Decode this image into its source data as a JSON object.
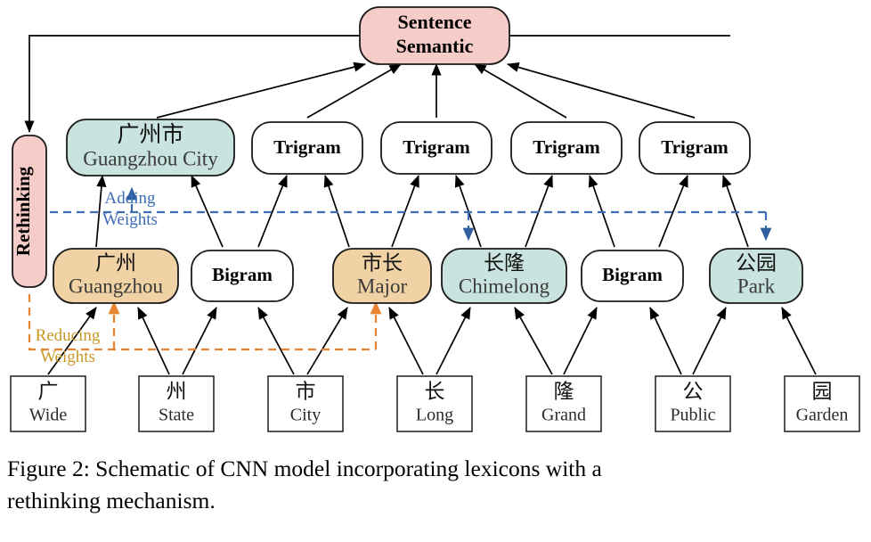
{
  "figure": {
    "caption_line1": "Figure 2:  Schematic of CNN model incorporating lexicons with a",
    "caption_line2": "rethinking mechanism."
  },
  "colors": {
    "pink": "#F5CCC8",
    "teal": "#C9E3DF",
    "orange": "#F0D2A4",
    "white": "#FFFFFF",
    "blue_annotation": "#3C6CB4",
    "orange_annotation": "#C79A28",
    "edge": "#000000"
  },
  "top": {
    "sentence_semantic_line1": "Sentence",
    "sentence_semantic_line2": "Semantic"
  },
  "rethinking": {
    "label": "Rethinking"
  },
  "annotations": {
    "adding_line1": "Adding",
    "adding_line2": "Weights",
    "reducing_line1": "Reducing",
    "reducing_line2": "Weights"
  },
  "layer_trigram": [
    {
      "id": "guangzhou-city",
      "cn": "广州市",
      "en": "Guangzhou City",
      "fill": "teal"
    },
    {
      "id": "trigram-1",
      "label": "Trigram",
      "fill": "white"
    },
    {
      "id": "trigram-2",
      "label": "Trigram",
      "fill": "white"
    },
    {
      "id": "trigram-3",
      "label": "Trigram",
      "fill": "white"
    },
    {
      "id": "trigram-4",
      "label": "Trigram",
      "fill": "white"
    }
  ],
  "layer_bigram": [
    {
      "id": "guangzhou",
      "cn": "广州",
      "en": "Guangzhou",
      "fill": "orange"
    },
    {
      "id": "bigram-1",
      "label": "Bigram",
      "fill": "white"
    },
    {
      "id": "major",
      "cn": "市长",
      "en": "Major",
      "fill": "orange"
    },
    {
      "id": "chimelong",
      "cn": "长隆",
      "en": "Chimelong",
      "fill": "teal"
    },
    {
      "id": "bigram-2",
      "label": "Bigram",
      "fill": "white"
    },
    {
      "id": "park",
      "cn": "公园",
      "en": "Park",
      "fill": "teal"
    }
  ],
  "layer_chars": [
    {
      "id": "char-guang",
      "cn": "广",
      "en": "Wide"
    },
    {
      "id": "char-zhou",
      "cn": "州",
      "en": "State"
    },
    {
      "id": "char-shi",
      "cn": "市",
      "en": "City"
    },
    {
      "id": "char-chang",
      "cn": "长",
      "en": "Long"
    },
    {
      "id": "char-long",
      "cn": "隆",
      "en": "Grand"
    },
    {
      "id": "char-gong",
      "cn": "公",
      "en": "Public"
    },
    {
      "id": "char-yuan",
      "cn": "园",
      "en": "Garden"
    }
  ]
}
